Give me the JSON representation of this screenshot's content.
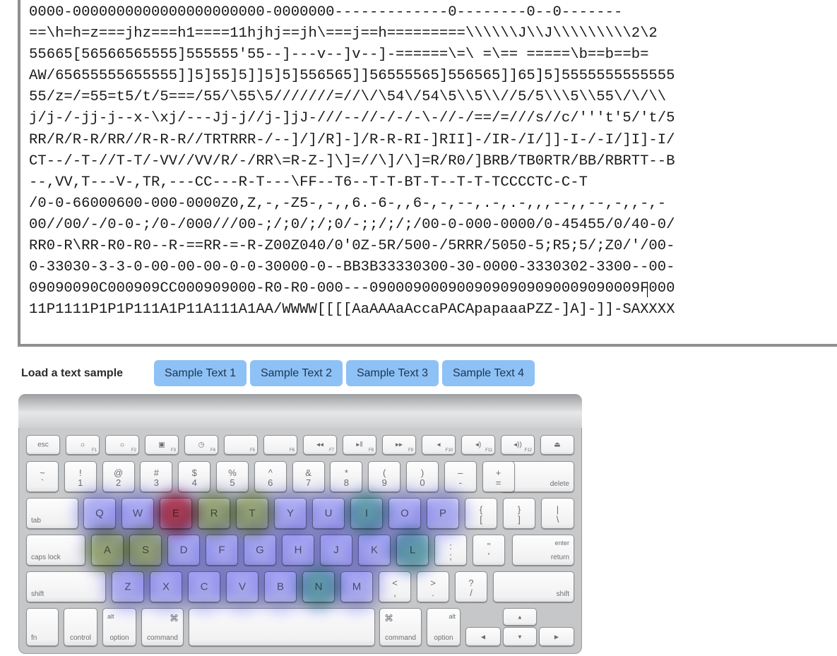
{
  "text_area": {
    "lines": [
      "0000-0000000000000000000000-0000000-------------0--------0--0-------",
      "==\\h=h=z===jhz===h1====11hjhj==jh\\===j==h=========\\\\\\\\\\\\J\\\\J\\\\\\\\\\\\\\\\\\2\\2",
      "55665[56566565555]555555'55--]---v--]v--]-======\\=\\ =\\== =====\\b==b==b=",
      "AW/65655555655555]]5]55]5]]5]5]556565]]56555565]556565]]65]5]5555555555555",
      "55/z=/=55=t5/t/5===/55/\\55\\5///////=//\\/\\54\\/54\\5\\\\5\\\\//5/5\\\\\\5\\\\55\\/\\/\\\\",
      "j/j-/-jj-j--x-\\xj/---Jj-j//j-]jJ-///--//-/-/-\\-//-/==/=///s//c/'''t'5/'t/5",
      "RR/R/R-R/RR//R-R-R//TRTRRR-/--]/]/R]-]/R-R-RI-]RII]-/IR-/I/]]-I-/-I/]I]-I/",
      "CT--/-T-//T-T/-VV//VV/R/-/RR\\=R-Z-]\\]=//\\]/\\]=R/R0/]BRB/TB0RTR/BB/RBRTT--B",
      "--,VV,T---V-,TR,---CC---R-T---\\FF--T6--T-T-BT-T--T-T-TCCCCTC-C-T",
      "/0-0-66000600-000-0000Z0,Z,-,-Z5-,-,,6.-6-,,6-,-,--,.-,.-,,,--,,--,-,,-,-",
      "00//00/-/0-0-;/0-/000///00-;/;0/;/;0/-;;/;/;/00-0-000-0000/0-45455/0/40-0/",
      "RR0-R\\RR-R0-R0--R-==RR-=-R-Z00Z040/0'0Z-5R/500-/5RRR/5050-5;R5;5/;Z0/'/00-",
      "0-33030-3-3-0-00-00-00-0-0-30000-0--BB3B33330300-30-0000-3330302-3300--00-",
      "09090090C000909CC000909000-R0-R0-000---0900090009009090909090009090009F000",
      "11P1111P1P1P111A1P11A111A1AA/WWWW[[[[AaAAAaAccaPACApapaaaPZZ-]A]-]]-SAXXXX"
    ]
  },
  "samples": {
    "label": "Load a text sample",
    "buttons": [
      "Sample Text 1",
      "Sample Text 2",
      "Sample Text 3",
      "Sample Text 4"
    ]
  },
  "keyboard": {
    "fn_row": {
      "esc": "esc",
      "f1": "F1",
      "f2": "F2",
      "f3": "F3",
      "f4": "F4",
      "f5": "F5",
      "f6": "F6",
      "f7": "F7",
      "f8": "F8",
      "f9": "F9",
      "f10": "F10",
      "f11": "F11",
      "f12": "F12",
      "f1_sym": "☼",
      "f2_sym": "☼",
      "f3_sym": "▣",
      "f4_sym": "◷",
      "f7_sym": "◂◂",
      "f8_sym": "▸‖",
      "f9_sym": "▸▸",
      "f10_sym": "◂",
      "f11_sym": "◂)",
      "f12_sym": "◂))",
      "eject": "⏏"
    },
    "number_row": [
      {
        "up": "~",
        "lo": "`"
      },
      {
        "up": "!",
        "lo": "1"
      },
      {
        "up": "@",
        "lo": "2"
      },
      {
        "up": "#",
        "lo": "3"
      },
      {
        "up": "$",
        "lo": "4"
      },
      {
        "up": "%",
        "lo": "5"
      },
      {
        "up": "^",
        "lo": "6"
      },
      {
        "up": "&",
        "lo": "7"
      },
      {
        "up": "*",
        "lo": "8"
      },
      {
        "up": "(",
        "lo": "9"
      },
      {
        "up": ")",
        "lo": "0"
      },
      {
        "up": "–",
        "lo": "-"
      },
      {
        "up": "+",
        "lo": "="
      }
    ],
    "delete": "delete",
    "tab": "tab",
    "qwerty": [
      "Q",
      "W",
      "E",
      "R",
      "T",
      "Y",
      "U",
      "I",
      "O",
      "P"
    ],
    "bracket_open": {
      "up": "{",
      "lo": "["
    },
    "bracket_close": {
      "up": "}",
      "lo": "]"
    },
    "backslash": {
      "up": "|",
      "lo": "\\"
    },
    "caps_lock": "caps lock",
    "home_row": [
      "A",
      "S",
      "D",
      "F",
      "G",
      "H",
      "J",
      "K",
      "L"
    ],
    "semicolon": {
      "up": ":",
      "lo": ";"
    },
    "quote": {
      "up": "\"",
      "lo": "'"
    },
    "enter": "enter",
    "return": "return",
    "shift": "shift",
    "bottom_row": [
      "Z",
      "X",
      "C",
      "V",
      "B",
      "N",
      "M"
    ],
    "comma": {
      "up": "<",
      "lo": ","
    },
    "period": {
      "up": ">",
      "lo": "."
    },
    "slash": {
      "up": "?",
      "lo": "/"
    },
    "fn": "fn",
    "control": "control",
    "alt": "alt",
    "option": "option",
    "cmd_sym": "⌘",
    "command": "command",
    "arrow_up": "▲",
    "arrow_down": "▼",
    "arrow_left": "◀",
    "arrow_right": "▶"
  },
  "heatmap": {
    "colors": {
      "hot": "#ff3b3b",
      "warm": "#d8f266",
      "mid": "#7fe6a8",
      "cool": "#6b6bf0"
    },
    "key_levels": {
      "E": "hot",
      "R": "warm",
      "T": "warm",
      "A": "warm",
      "S": "warm",
      "I": "mid",
      "O": "cool",
      "L": "mid",
      "N": "mid",
      "W": "cool",
      "Q": "cool",
      "D": "cool",
      "F": "cool",
      "G": "cool",
      "H": "cool",
      "J": "cool",
      "K": "cool",
      "U": "cool",
      "Y": "cool",
      "P": "cool",
      "C": "cool",
      "M": "cool",
      "V": "cool",
      "B": "cool",
      "X": "cool",
      "Z": "cool"
    }
  }
}
